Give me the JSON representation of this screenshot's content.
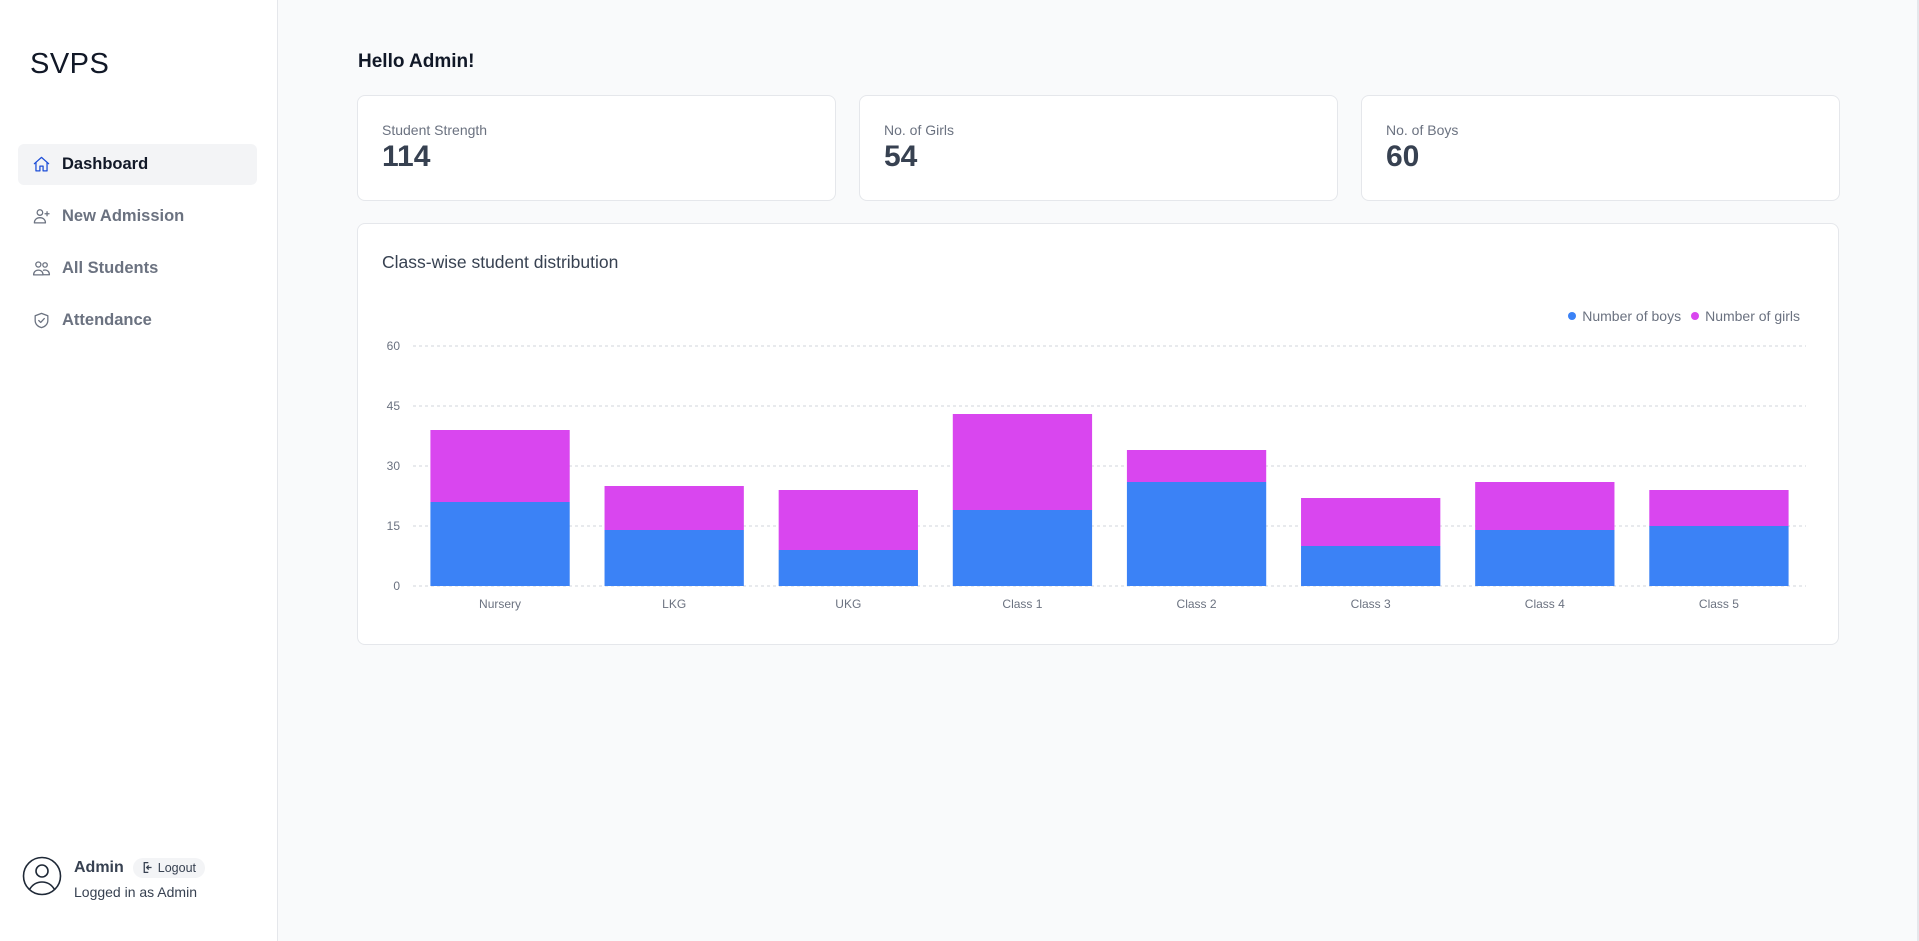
{
  "app": {
    "brand": "SVPS"
  },
  "sidebar": {
    "items": [
      {
        "label": "Dashboard",
        "icon": "home-icon",
        "active": true
      },
      {
        "label": "New Admission",
        "icon": "user-plus-icon",
        "active": false
      },
      {
        "label": "All Students",
        "icon": "users-icon",
        "active": false
      },
      {
        "label": "Attendance",
        "icon": "shield-check-icon",
        "active": false
      }
    ],
    "user": {
      "name": "Admin",
      "logout_label": "Logout",
      "status": "Logged in as Admin"
    }
  },
  "main": {
    "greeting": "Hello Admin!",
    "stats": [
      {
        "label": "Student Strength",
        "value": "114"
      },
      {
        "label": "No. of Girls",
        "value": "54"
      },
      {
        "label": "No. of Boys",
        "value": "60"
      }
    ]
  },
  "colors": {
    "boys": "#3b82f6",
    "girls": "#d946ef",
    "active_icon": "#1d4ed8"
  },
  "chart_data": {
    "type": "bar",
    "stacked": true,
    "title": "Class-wise student distribution",
    "categories": [
      "Nursery",
      "LKG",
      "UKG",
      "Class 1",
      "Class 2",
      "Class 3",
      "Class 4",
      "Class 5"
    ],
    "series": [
      {
        "name": "Number of boys",
        "color": "#3b82f6",
        "values": [
          21,
          14,
          9,
          19,
          26,
          10,
          14,
          15
        ]
      },
      {
        "name": "Number of girls",
        "color": "#d946ef",
        "values": [
          18,
          11,
          15,
          24,
          8,
          12,
          12,
          9
        ]
      }
    ],
    "xlabel": "",
    "ylabel": "",
    "ylim": [
      0,
      60
    ],
    "yticks": [
      0,
      15,
      30,
      45,
      60
    ],
    "grid": true,
    "legend_position": "top-right"
  }
}
